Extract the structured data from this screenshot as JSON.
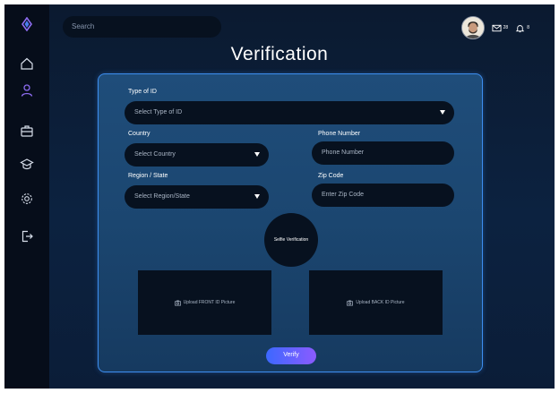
{
  "search": {
    "placeholder": "Search"
  },
  "topbar": {
    "mail_count": "28",
    "notification_count": "8"
  },
  "page": {
    "title": "Verification"
  },
  "form": {
    "id_type": {
      "label": "Type of ID",
      "value": "Select Type of ID"
    },
    "country": {
      "label": "Country",
      "value": "Select Country"
    },
    "phone": {
      "label": "Phone Number",
      "placeholder": "Phone Number"
    },
    "region": {
      "label": "Region / State",
      "value": "Select Region/State"
    },
    "zip": {
      "label": "Zip Code",
      "placeholder": "Enter Zip Code"
    },
    "selfie_label": "Selfie Verification",
    "upload_front_label": "Upload FRONT ID Picture",
    "upload_back_label": "Upload BACK ID Picture",
    "verify_label": "Verify"
  },
  "sidebar": {
    "items": [
      {
        "icon": "logo-diamond-icon"
      },
      {
        "icon": "home-icon"
      },
      {
        "icon": "user-icon"
      },
      {
        "icon": "briefcase-icon"
      },
      {
        "icon": "graduation-cap-icon"
      },
      {
        "icon": "gear-icon"
      },
      {
        "icon": "logout-icon"
      }
    ]
  },
  "colors": {
    "accent": "#3d8ef0",
    "sidebar_bg": "#060d1a",
    "field_bg": "#07111f",
    "verify_gradient_start": "#3c68ff",
    "verify_gradient_end": "#8b5bff"
  }
}
